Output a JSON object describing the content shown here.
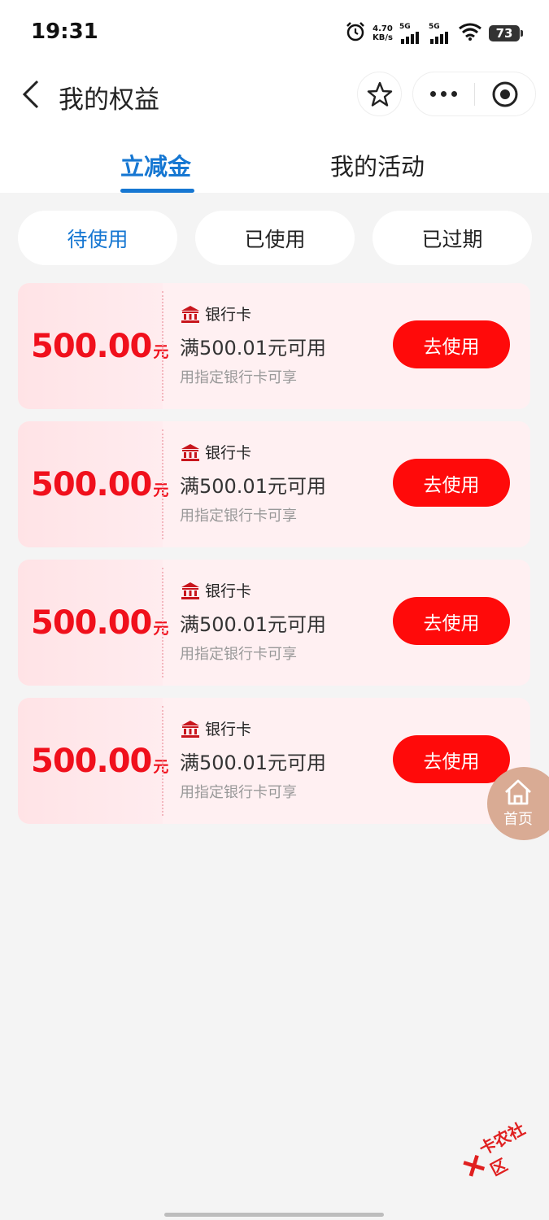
{
  "status_bar": {
    "time": "19:31",
    "net_speed_value": "4.70",
    "net_speed_unit": "KB/s",
    "signal_1": "5G",
    "signal_2": "5G",
    "battery": "73"
  },
  "nav": {
    "title": "我的权益"
  },
  "tabs": [
    {
      "label": "立减金",
      "active": true
    },
    {
      "label": "我的活动",
      "active": false
    }
  ],
  "filters": [
    {
      "label": "待使用",
      "active": true
    },
    {
      "label": "已使用",
      "active": false
    },
    {
      "label": "已过期",
      "active": false
    }
  ],
  "coupons": [
    {
      "amount": "500.00",
      "unit": "元",
      "type": "银行卡",
      "condition": "满500.01元可用",
      "note": "用指定银行卡可享",
      "button": "去使用"
    },
    {
      "amount": "500.00",
      "unit": "元",
      "type": "银行卡",
      "condition": "满500.01元可用",
      "note": "用指定银行卡可享",
      "button": "去使用"
    },
    {
      "amount": "500.00",
      "unit": "元",
      "type": "银行卡",
      "condition": "满500.01元可用",
      "note": "用指定银行卡可享",
      "button": "去使用"
    },
    {
      "amount": "500.00",
      "unit": "元",
      "type": "银行卡",
      "condition": "满500.01元可用",
      "note": "用指定银行卡可享",
      "button": "去使用"
    }
  ],
  "home_float": {
    "label": "首页"
  },
  "watermark": {
    "text": "卡农社区"
  },
  "colors": {
    "accent_blue": "#1677d2",
    "coupon_red": "#f0101c",
    "button_red": "#ff0a0a",
    "coupon_bg": "#fff0f2",
    "home_float": "#d9ab94"
  },
  "icons": {
    "back": "chevron-left-icon",
    "favorite": "star-icon",
    "more": "more-dots-icon",
    "close": "target-close-icon",
    "bank": "bank-icon",
    "home": "home-icon"
  }
}
